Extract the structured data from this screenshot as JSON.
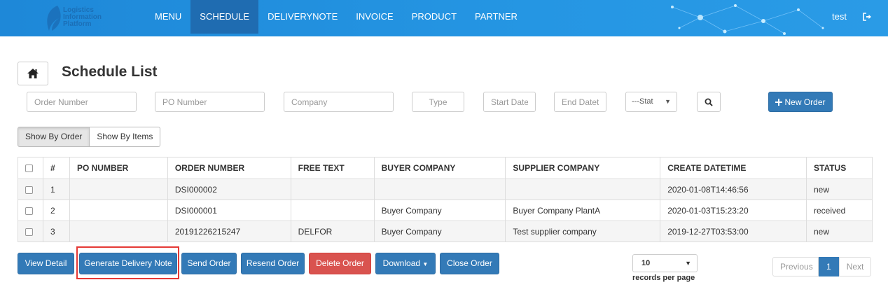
{
  "brand": {
    "line1": "Logistics",
    "line2": "Information",
    "line3": "Platform",
    "color": "#1b6fb7"
  },
  "nav": {
    "items": [
      "MENU",
      "SCHEDULE",
      "DELIVERYNOTE",
      "INVOICE",
      "PRODUCT",
      "PARTNER"
    ],
    "active": "SCHEDULE",
    "user": "test",
    "bar_color": "#2596e3",
    "active_color": "#1f6cb1"
  },
  "page": {
    "title": "Schedule List"
  },
  "filters": {
    "order_number": {
      "placeholder": "Order Number",
      "value": ""
    },
    "po_number": {
      "placeholder": "PO Number",
      "value": ""
    },
    "company": {
      "placeholder": "Company",
      "value": ""
    },
    "type": {
      "placeholder": "Type",
      "value": ""
    },
    "start_date": {
      "placeholder": "Start Date",
      "value": ""
    },
    "end_date": {
      "placeholder": "End Datet",
      "value": ""
    },
    "status_selected": "---Stat",
    "new_order_label": "New Order"
  },
  "view_toggle": {
    "by_order": "Show By Order",
    "by_items": "Show By Items",
    "selected": "Show By Order"
  },
  "table": {
    "columns": [
      "#",
      "PO NUMBER",
      "ORDER NUMBER",
      "FREE TEXT",
      "BUYER COMPANY",
      "SUPPLIER COMPANY",
      "CREATE DATETIME",
      "STATUS"
    ],
    "rows": [
      {
        "num": "1",
        "po_number": "",
        "order_number": "DSI000002",
        "free_text": "",
        "buyer": "",
        "supplier": "",
        "created": "2020-01-08T14:46:56",
        "status": "new"
      },
      {
        "num": "2",
        "po_number": "",
        "order_number": "DSI000001",
        "free_text": "",
        "buyer": "Buyer Company",
        "supplier": "Buyer Company PlantA",
        "created": "2020-01-03T15:23:20",
        "status": "received"
      },
      {
        "num": "3",
        "po_number": "",
        "order_number": "20191226215247",
        "free_text": "DELFOR",
        "buyer": "Buyer Company",
        "supplier": "Test supplier company",
        "created": "2019-12-27T03:53:00",
        "status": "new"
      }
    ]
  },
  "actions": {
    "view_detail": "View Detail",
    "generate_delivery_note": "Generate Delivery Note",
    "send_order": "Send Order",
    "resend_order": "Resend Order",
    "delete_order": "Delete Order",
    "download": "Download",
    "close_order": "Close Order",
    "primary_color": "#337ab7",
    "danger_color": "#d9534f",
    "highlight_color": "#e53935"
  },
  "pagination": {
    "records_per_page_value": "10",
    "records_per_page_label": "records per page",
    "previous": "Previous",
    "current_page": "1",
    "next": "Next"
  },
  "icons": {
    "home": "home-icon",
    "search": "search-icon",
    "plus": "plus-icon",
    "logout": "logout-icon",
    "caret": "caret-down-icon"
  }
}
